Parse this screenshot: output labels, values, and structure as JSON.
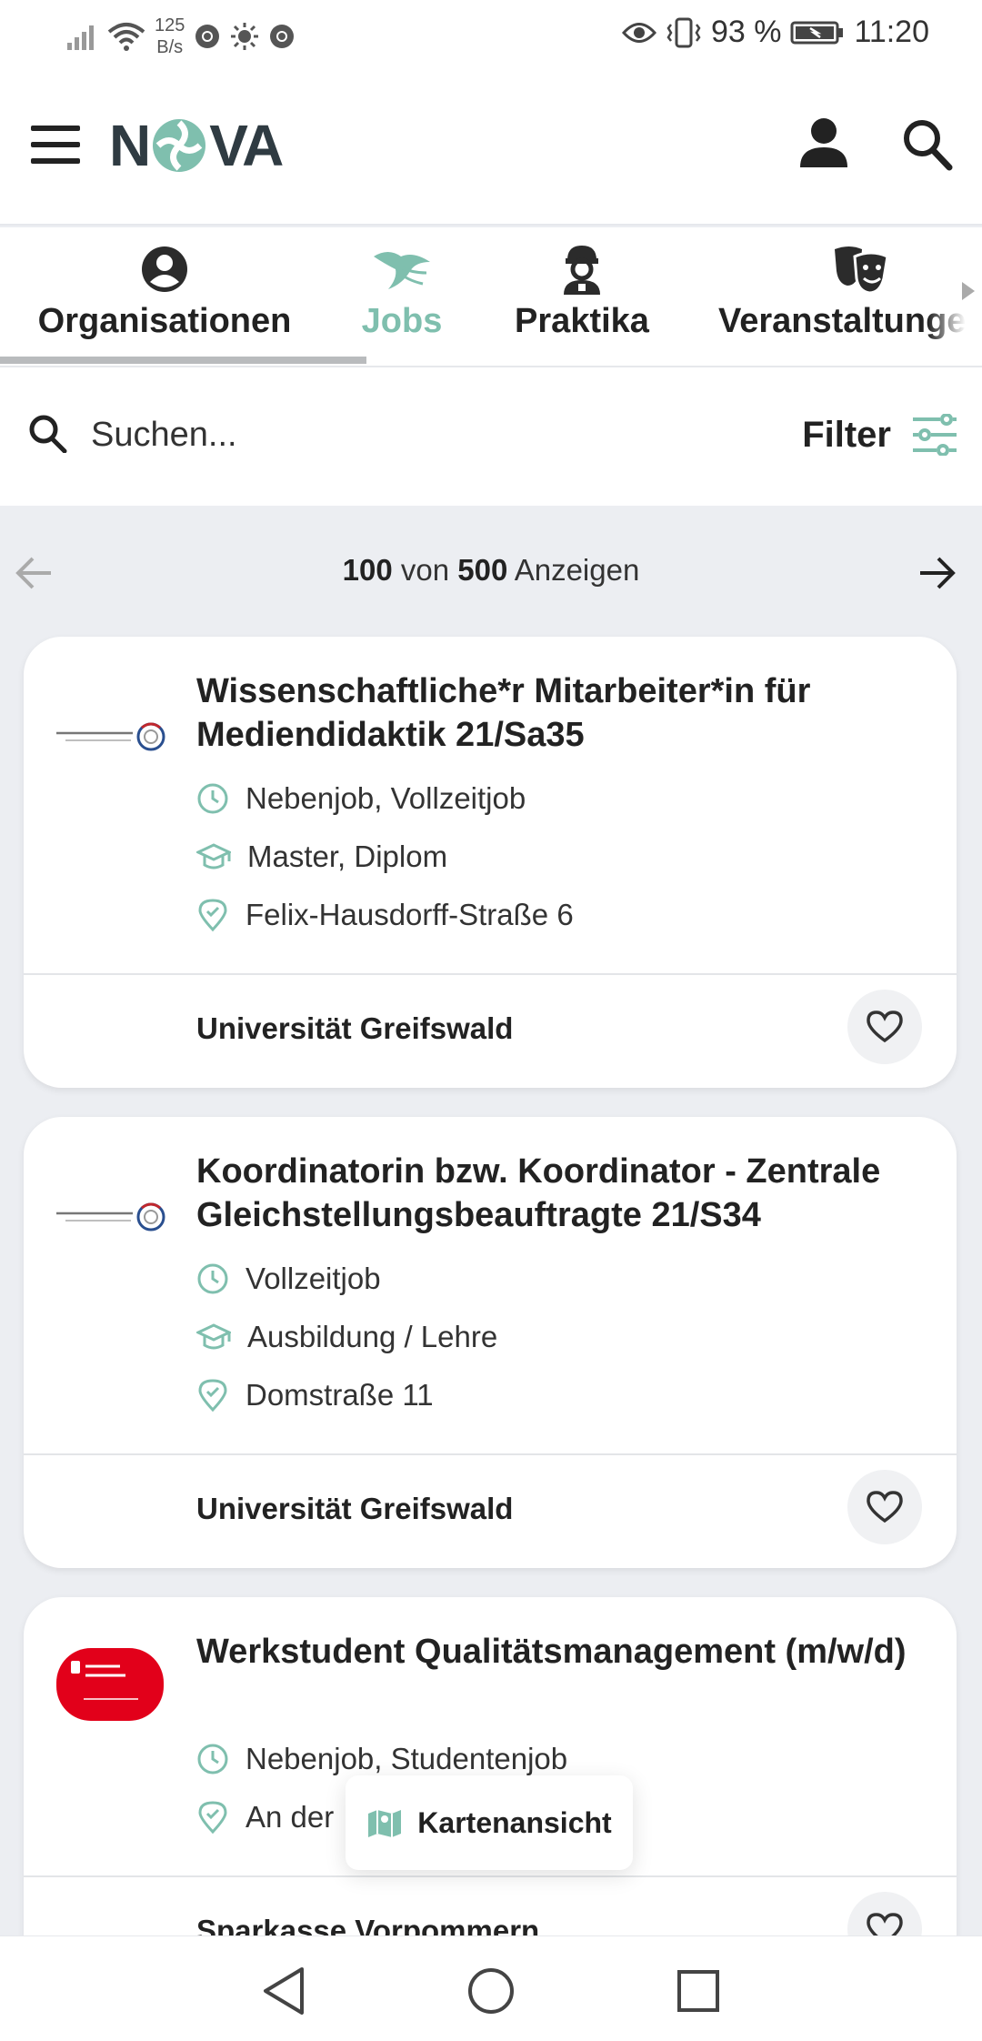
{
  "status_bar": {
    "net_speed_value": "125",
    "net_speed_unit": "B/s",
    "battery": "93 %",
    "time": "11:20"
  },
  "header": {
    "logo_left": "N",
    "logo_right": "VA"
  },
  "tabs": [
    {
      "label": "Organisationen",
      "icon": "account-circle-icon",
      "active": false
    },
    {
      "label": "Jobs",
      "icon": "bird-icon",
      "active": true
    },
    {
      "label": "Praktika",
      "icon": "worker-icon",
      "active": false
    },
    {
      "label": "Veranstaltungen",
      "icon": "theater-masks-icon",
      "active": false
    }
  ],
  "search": {
    "placeholder": "Suchen...",
    "filter_label": "Filter"
  },
  "pager": {
    "shown": "100",
    "von": "von",
    "total": "500",
    "suffix": "Anzeigen"
  },
  "listings": [
    {
      "title": "Wissenschaftliche*r Mitarbeiter*in für Mediendidaktik 21/Sa35",
      "job_type": "Nebenjob, Vollzeitjob",
      "degree": "Master, Diplom",
      "location": "Felix-Hausdorff-Straße 6",
      "organization": "Universität Greifswald",
      "logo": "universitaet-greifswald-logo"
    },
    {
      "title": "Koordinatorin bzw. Koordinator - Zentrale Gleichstellungsbeauftragte 21/S34",
      "job_type": "Vollzeitjob",
      "degree": "Ausbildung / Lehre",
      "location": "Domstraße 11",
      "organization": "Universität Greifswald",
      "logo": "universitaet-greifswald-logo"
    },
    {
      "title": "Werkstudent Qualitätsmanagement (m/w/d)",
      "job_type": "Nebenjob, Studentenjob",
      "location": "An der",
      "organization": "Sparkasse Vorpommern",
      "logo": "sparkasse-vorpommern-logo"
    }
  ],
  "map_button": {
    "label": "Kartenansicht"
  },
  "colors": {
    "accent": "#7fbfae",
    "text": "#222222",
    "background": "#eceef2",
    "sparkasse_red": "#e2001a"
  }
}
